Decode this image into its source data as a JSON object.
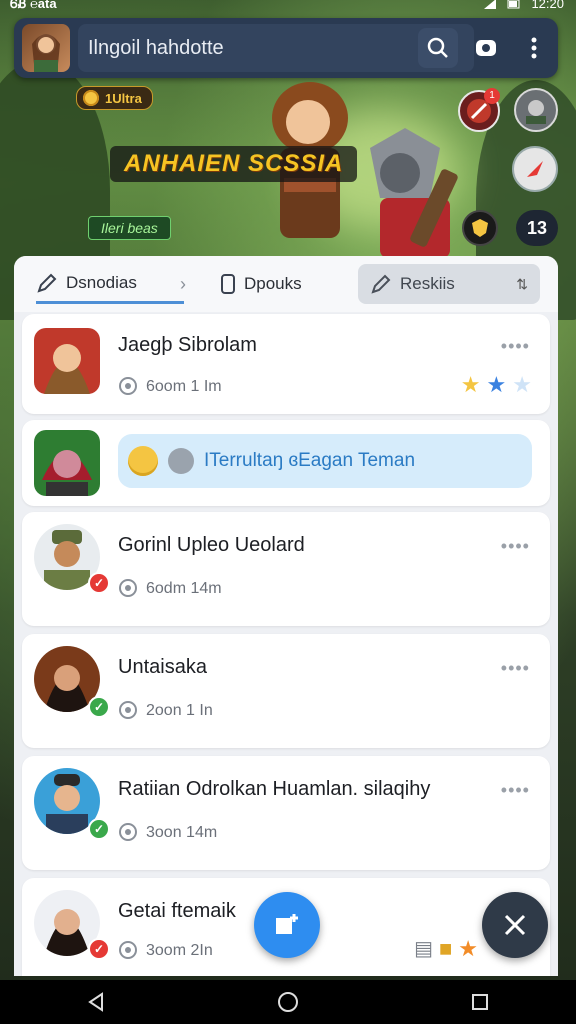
{
  "status_bar": {
    "left_text": "ᏮᏰ ℮ata",
    "time": "12:20"
  },
  "top_bar": {
    "search_text": "Ilngoil hahdotte"
  },
  "banner": {
    "coins": "1Ultra",
    "title": "ANHAIEN SCSSIA",
    "tag": "Ileri beas",
    "notif_count": "1",
    "counter": "13"
  },
  "tabs": [
    {
      "label": "Dsnodias"
    },
    {
      "label": "Dpouks"
    },
    {
      "label": "Reskiis"
    }
  ],
  "items": [
    {
      "name": "Jaegþ Sibrolam",
      "meta": "6oom 1 Im"
    },
    {
      "message": "ITerrultaŋ ɞEagan Teman"
    },
    {
      "name": "Gorinl Upleo Ueolard",
      "meta": "6odm 14m"
    },
    {
      "name": "Untaisaka",
      "meta": "2oon 1 In"
    },
    {
      "name": "Ratiian Odrolkan Huamlan. silaqihy",
      "meta": "3oon 14m"
    },
    {
      "name": "Getai ftemaik",
      "meta": "3oom 2In"
    }
  ],
  "colors": {
    "accent": "#2e8df0",
    "tab_underline": "#4d8fd6",
    "banner_title": "#f5c423"
  }
}
